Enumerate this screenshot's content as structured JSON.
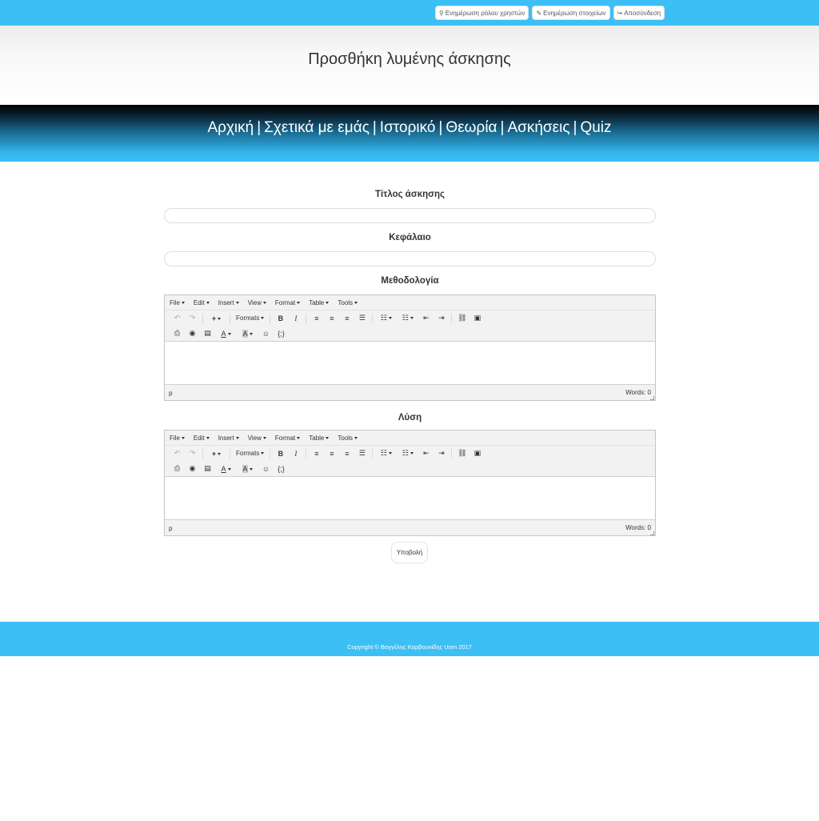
{
  "topbar": {
    "buttons": [
      {
        "icon": "⚲",
        "label": "Ενημέρωση ρόλου χρηστών"
      },
      {
        "icon": "✎",
        "label": "Ενημέρωση στοιχείων"
      },
      {
        "icon": "↪",
        "label": "Αποσύνδεση"
      }
    ]
  },
  "header": {
    "title": "Προσθήκη λυμένης άσκησης"
  },
  "nav": {
    "items": [
      "Αρχική",
      "Σχετικά με εμάς",
      "Ιστορικό",
      "Θεωρία",
      "Ασκήσεις",
      "Quiz"
    ],
    "separator": "|"
  },
  "form": {
    "title_label": "Τίτλος άσκησης",
    "chapter_label": "Κεφάλαιο",
    "methodology_label": "Μεθοδολογία",
    "solution_label": "Λύση",
    "submit_label": "Υποβολή"
  },
  "editor": {
    "menu": [
      "File",
      "Edit",
      "Insert",
      "View",
      "Format",
      "Table",
      "Tools"
    ],
    "formats_label": "Formats",
    "path": "p",
    "words": "Words: 0"
  },
  "footer": {
    "copyright": "Copyright © Βαγγέλης Καρβουνίδης Uom 2017"
  },
  "colors": {
    "accent": "#3bbff5",
    "nav_dark": "#000000"
  }
}
